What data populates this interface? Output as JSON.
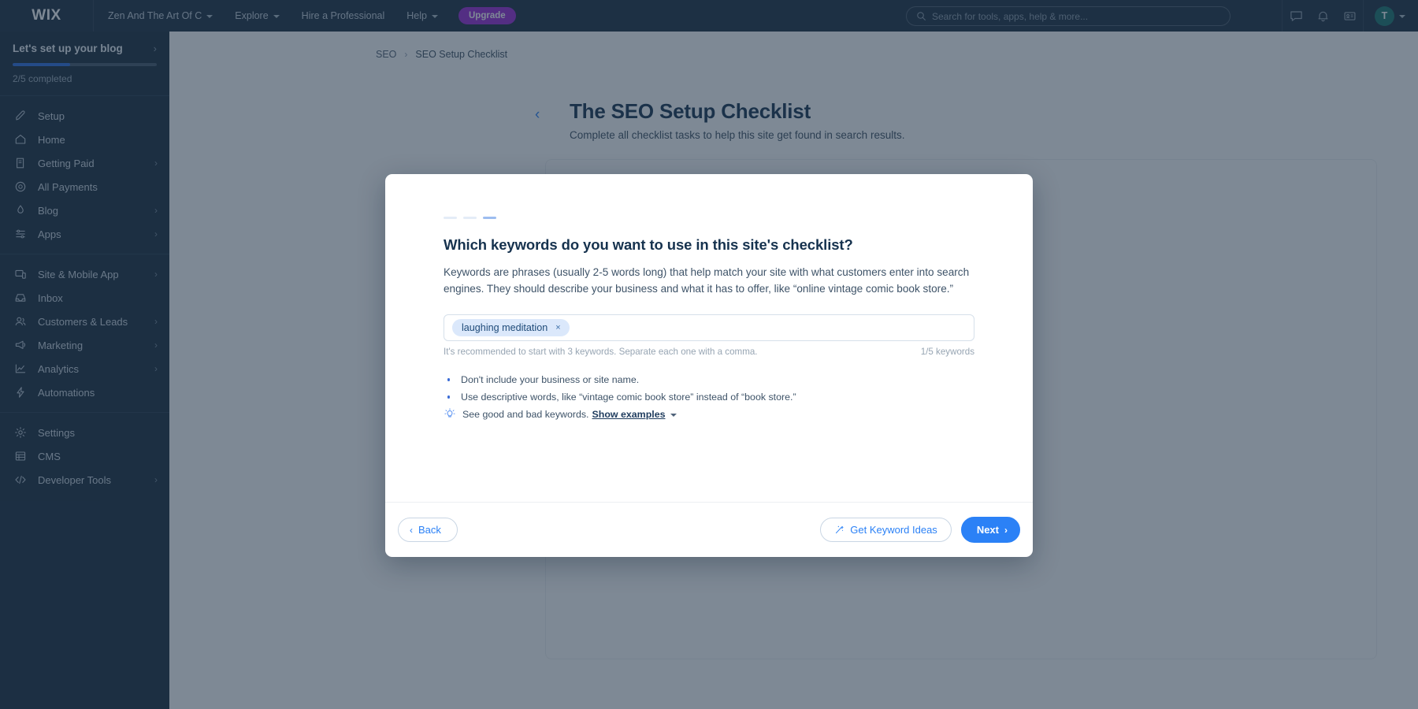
{
  "topbar": {
    "logo": "WIX",
    "site_name": "Zen And The Art Of C",
    "explore": "Explore",
    "hire": "Hire a Professional",
    "help": "Help",
    "upgrade": "Upgrade",
    "search_placeholder": "Search for tools, apps, help & more...",
    "avatar_initial": "T"
  },
  "sidebar": {
    "setup": {
      "title": "Let's set up your blog",
      "progress_percent": 40,
      "completed_label": "2/5 completed"
    },
    "groups": [
      {
        "items": [
          {
            "label": "Setup",
            "icon": "rocket-icon",
            "chevron": false
          },
          {
            "label": "Home",
            "icon": "home-icon",
            "chevron": false
          },
          {
            "label": "Getting Paid",
            "icon": "invoice-icon",
            "chevron": true
          },
          {
            "label": "All Payments",
            "icon": "coin-icon",
            "chevron": false
          },
          {
            "label": "Blog",
            "icon": "pen-icon",
            "chevron": true
          },
          {
            "label": "Apps",
            "icon": "apps-icon",
            "chevron": true
          }
        ]
      },
      {
        "items": [
          {
            "label": "Site & Mobile App",
            "icon": "monitor-icon",
            "chevron": true
          },
          {
            "label": "Inbox",
            "icon": "inbox-icon",
            "chevron": false
          },
          {
            "label": "Customers & Leads",
            "icon": "people-icon",
            "chevron": true
          },
          {
            "label": "Marketing",
            "icon": "megaphone-icon",
            "chevron": true
          },
          {
            "label": "Analytics",
            "icon": "chart-icon",
            "chevron": true
          },
          {
            "label": "Automations",
            "icon": "bolt-icon",
            "chevron": false
          }
        ]
      },
      {
        "items": [
          {
            "label": "Settings",
            "icon": "gear-icon",
            "chevron": false
          },
          {
            "label": "CMS",
            "icon": "database-icon",
            "chevron": false
          },
          {
            "label": "Developer Tools",
            "icon": "code-icon",
            "chevron": true
          }
        ]
      }
    ]
  },
  "page": {
    "breadcrumb": {
      "root": "SEO",
      "separator": "›",
      "current": "SEO Setup Checklist"
    },
    "title": "The SEO Setup Checklist",
    "subtitle": "Complete all checklist tasks to help this site get found in search results."
  },
  "modal": {
    "steps": [
      {
        "active": false
      },
      {
        "active": false
      },
      {
        "active": true
      }
    ],
    "heading": "Which keywords do you want to use in this site's checklist?",
    "paragraph": "Keywords are phrases (usually 2-5 words long) that help match your site with what customers enter into search engines. They should describe your business and what it has to offer, like “online vintage comic book store.”",
    "tags": [
      {
        "label": "laughing meditation",
        "remove": "×"
      }
    ],
    "input_placeholder": "",
    "helper_text": "It's recommended to start with 3 keywords. Separate each one with a comma.",
    "counter": "1/5 keywords",
    "hints": [
      {
        "type": "bullet",
        "text": "Don't include your business or site name."
      },
      {
        "type": "bullet",
        "text": "Use descriptive words, like “vintage comic book store” instead of “book store.”"
      }
    ],
    "examples_row": {
      "icon": "lightbulb-icon",
      "text": "See good and bad keywords.",
      "link": "Show examples"
    },
    "footer": {
      "back": "Back",
      "keyword_ideas": "Get Keyword Ideas",
      "next": "Next"
    }
  },
  "colors": {
    "accent_blue": "#2b81f6",
    "sidebar_bg": "#17293b",
    "topbar_bg": "#192c3e",
    "upgrade_purple": "#9a27d5",
    "tag_bg": "#dbe8fb",
    "avatar_bg": "#17736b"
  }
}
